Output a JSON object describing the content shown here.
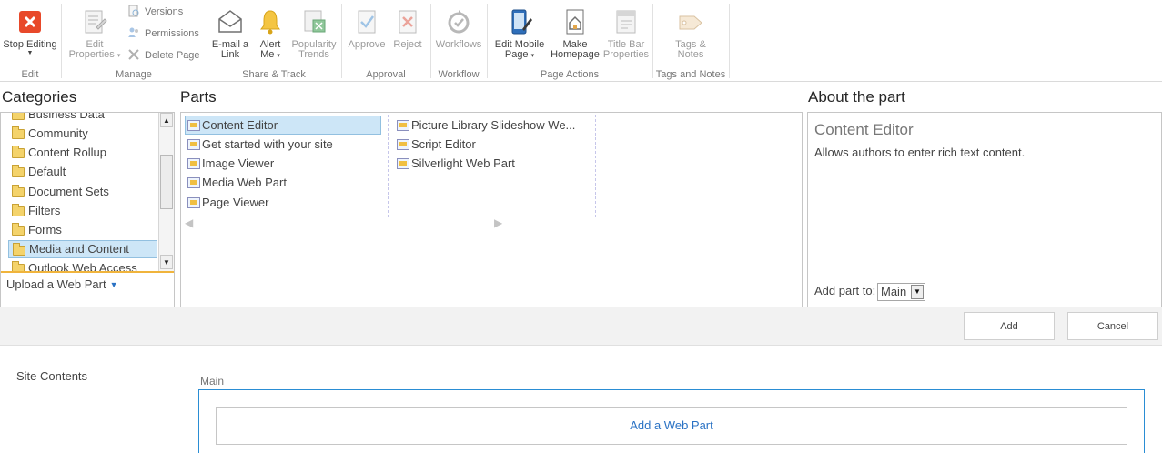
{
  "ribbon": {
    "groups": [
      {
        "label": "Edit"
      },
      {
        "label": "Manage"
      },
      {
        "label": "Share & Track"
      },
      {
        "label": "Approval"
      },
      {
        "label": "Workflow"
      },
      {
        "label": "Page Actions"
      },
      {
        "label": "Tags and Notes"
      }
    ],
    "stop_editing": "Stop Editing",
    "edit_properties": "Edit\nProperties",
    "versions": "Versions",
    "permissions": "Permissions",
    "delete_page": "Delete Page",
    "email_link": "E-mail a\nLink",
    "alert_me": "Alert\nMe",
    "popularity_trends": "Popularity\nTrends",
    "approve": "Approve",
    "reject": "Reject",
    "workflows": "Workflows",
    "edit_mobile_page": "Edit Mobile\nPage",
    "make_homepage": "Make\nHomepage",
    "title_bar_properties": "Title Bar\nProperties",
    "tags_notes": "Tags &\nNotes"
  },
  "categories": {
    "title": "Categories",
    "items": [
      "Business Data",
      "Community",
      "Content Rollup",
      "Default",
      "Document Sets",
      "Filters",
      "Forms",
      "Media and Content",
      "Outlook Web Access"
    ],
    "selected": "Media and Content",
    "upload": "Upload a Web Part"
  },
  "parts": {
    "title": "Parts",
    "column1": [
      "Content Editor",
      "Get started with your site",
      "Image Viewer",
      "Media Web Part",
      "Page Viewer"
    ],
    "column2": [
      "Picture Library Slideshow We...",
      "Script Editor",
      "Silverlight Web Part"
    ],
    "selected": "Content Editor"
  },
  "about": {
    "title": "About the part",
    "name": "Content Editor",
    "description": "Allows authors to enter rich text content.",
    "add_part_to_label": "Add part to:",
    "add_part_to_value": "Main"
  },
  "actions": {
    "add": "Add",
    "cancel": "Cancel"
  },
  "page": {
    "left_nav_link": "Site Contents",
    "zone_label": "Main",
    "add_web_part": "Add a Web Part"
  },
  "colors": {
    "accent": "#2a72c4",
    "selection": "#cde6f7",
    "stop_icon": "#e8492a"
  }
}
